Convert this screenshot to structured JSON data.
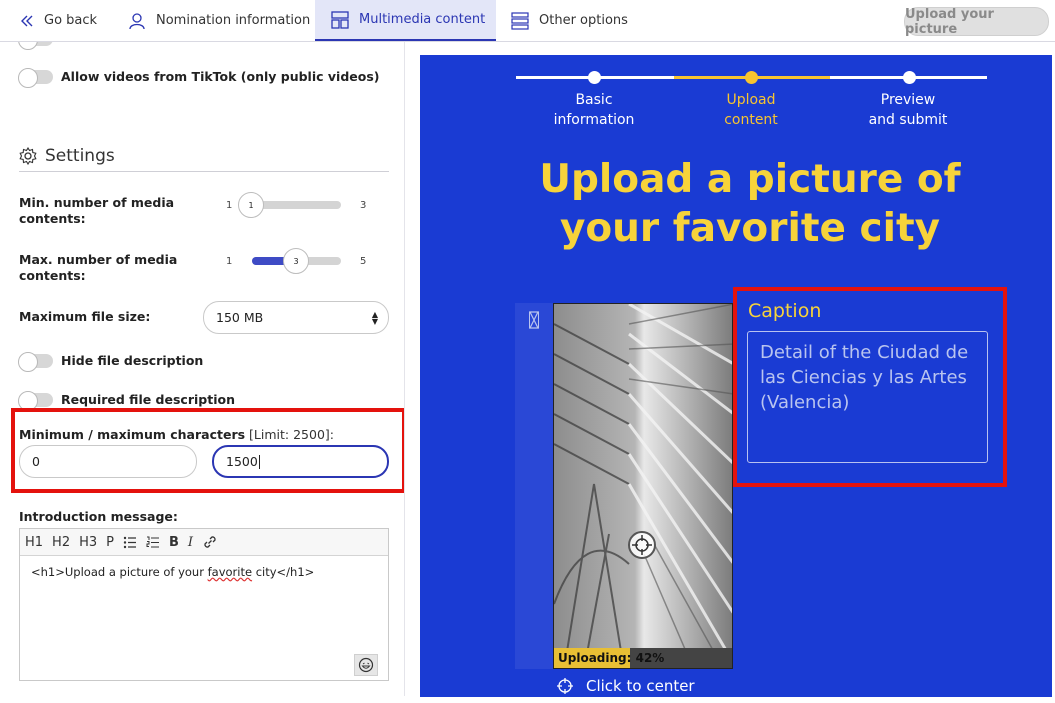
{
  "nav": {
    "back_label": "Go back",
    "nomination_label": "Nomination information",
    "multimedia_label": "Multimedia content",
    "other_label": "Other options",
    "upload_button": "Upload your picture"
  },
  "left": {
    "tiktok_label": "Allow videos from TikTok (only public videos)",
    "settings_title": "Settings",
    "min_media": {
      "label": "Min. number of media contents:",
      "min": "1",
      "max": "3",
      "value": "1",
      "fraction": 0.0
    },
    "max_media": {
      "label": "Max. number of media contents:",
      "min": "1",
      "max": "5",
      "value": "3",
      "fraction": 0.5
    },
    "max_file_size": {
      "label": "Maximum file size:",
      "value": "150 MB"
    },
    "hide_desc_label": "Hide file description",
    "required_desc_label": "Required file description",
    "chars": {
      "label": "Minimum / maximum characters",
      "hint": "[Limit: 2500]:",
      "min_value": "0",
      "max_value": "1500"
    },
    "intro": {
      "label": "Introduction message:",
      "toolbar": [
        "H1",
        "H2",
        "H3",
        "P"
      ],
      "content_before": "<h1>Upload a picture of your ",
      "content_misspelled": "favorite",
      "content_after": " city</h1>"
    }
  },
  "preview": {
    "steps": [
      {
        "label_line1": "Basic",
        "label_line2": "information"
      },
      {
        "label_line1": "Upload",
        "label_line2": "content"
      },
      {
        "label_line1": "Preview",
        "label_line2": "and submit"
      }
    ],
    "headline_line1": "Upload a picture of",
    "headline_line2": "your favorite city",
    "caption_label": "Caption",
    "caption_placeholder": "Detail of the Ciudad de las Ciencias y las Artes (Valencia)",
    "uploading_label": "Uploading: ",
    "uploading_percent": "42%",
    "upload_progress": 0.42,
    "click_to_center": "Click to center"
  },
  "colors": {
    "accent": "#2b36b3",
    "preview_bg": "#1a3bd3",
    "highlight_yellow": "#f7d33a",
    "annotation_red": "#e4120d"
  }
}
